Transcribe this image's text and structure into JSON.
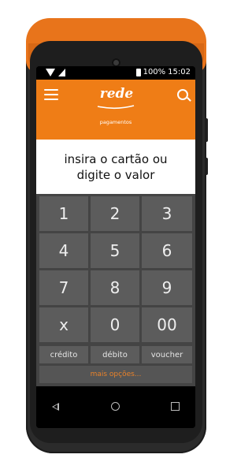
{
  "status_bar": {
    "battery_percent": "100%",
    "time": "15:02"
  },
  "header": {
    "brand": "rede",
    "page_label": "pagamentos",
    "accent_color": "#ef7d16",
    "icons": [
      "menu-icon",
      "search-icon"
    ]
  },
  "prompt": {
    "text": "insira o cartão ou\ndigite o valor"
  },
  "keypad": {
    "keys": [
      "1",
      "2",
      "3",
      "4",
      "5",
      "6",
      "7",
      "8",
      "9",
      "x",
      "0",
      "00"
    ]
  },
  "payment_types": {
    "options": [
      "crédito",
      "débito",
      "voucher"
    ],
    "more_options": "mais opções..."
  },
  "navigation": {
    "icons": [
      "back-icon",
      "home-icon",
      "recent-apps-icon"
    ]
  }
}
